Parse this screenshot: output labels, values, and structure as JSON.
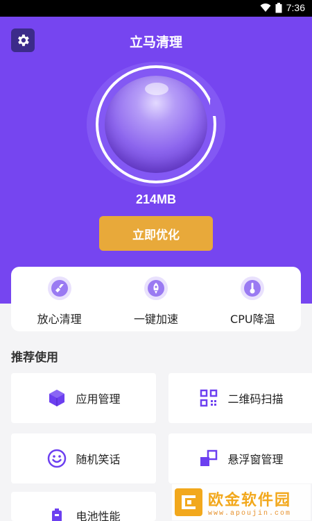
{
  "status_bar": {
    "time": "7:36"
  },
  "header": {
    "title": "立马清理"
  },
  "memory": {
    "freed": "214MB"
  },
  "actions": {
    "optimize_label": "立即优化"
  },
  "quick_tools": [
    {
      "label": "放心清理",
      "icon": "broom-icon"
    },
    {
      "label": "一键加速",
      "icon": "rocket-icon"
    },
    {
      "label": "CPU降温",
      "icon": "thermometer-icon"
    }
  ],
  "recommended": {
    "title": "推荐使用",
    "items": [
      {
        "label": "应用管理",
        "icon": "cube-icon"
      },
      {
        "label": "二维码扫描",
        "icon": "qrcode-icon"
      },
      {
        "label": "随机笑话",
        "icon": "smiley-icon"
      },
      {
        "label": "悬浮窗管理",
        "icon": "floating-window-icon"
      },
      {
        "label": "电池性能",
        "icon": "battery-icon"
      }
    ]
  },
  "watermark": {
    "title": "欧金软件园",
    "url": "www.apoujin.com"
  },
  "colors": {
    "primary": "#7645f0",
    "accent": "#e8a93a",
    "icon": "#6c3ff0",
    "background": "#f4f4f6"
  }
}
